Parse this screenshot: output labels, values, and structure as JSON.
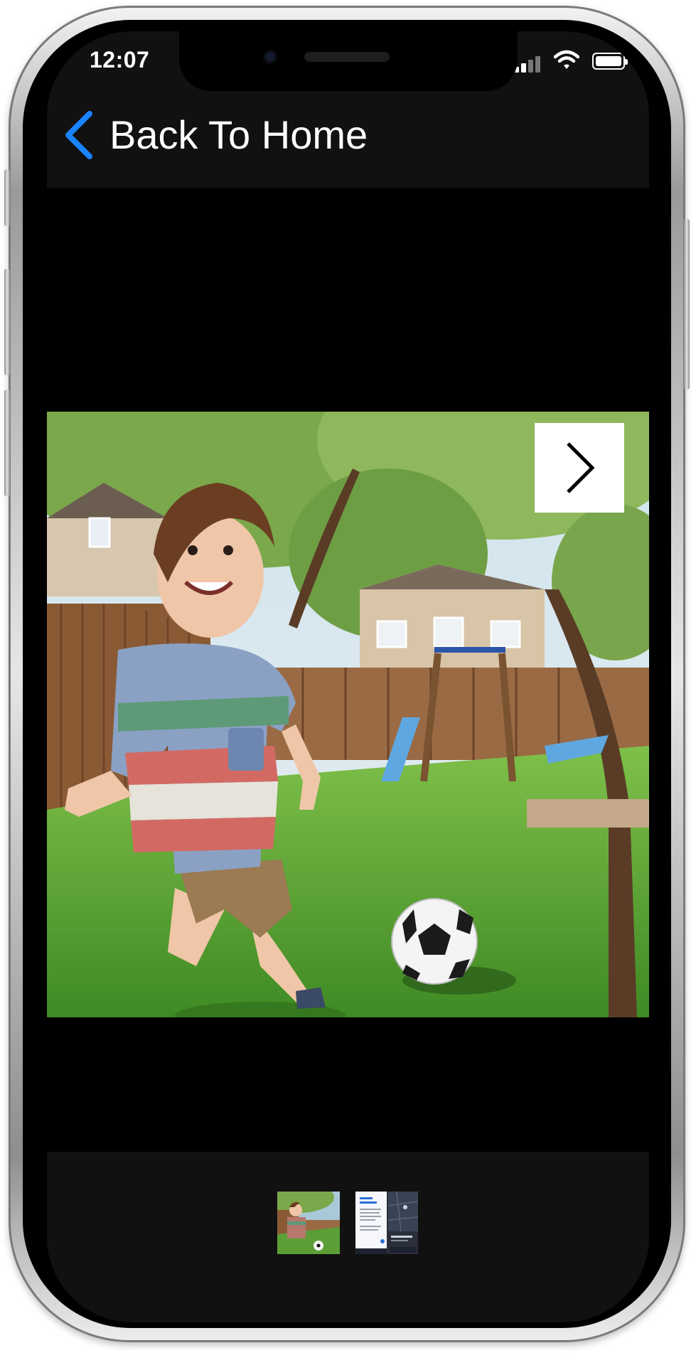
{
  "status_bar": {
    "time": "12:07",
    "icons": [
      "cellular-signal-icon",
      "wifi-icon",
      "battery-icon"
    ]
  },
  "nav": {
    "back_label": "Back To Home",
    "back_icon": "chevron-left-icon",
    "accent_color": "#1a84ff"
  },
  "viewer": {
    "image_subject": "boy-playing-soccer-in-backyard",
    "next_icon": "chevron-right-icon"
  },
  "thumbnails": [
    {
      "name": "thumbnail-boy-soccer",
      "selected": true
    },
    {
      "name": "thumbnail-app-screenshot",
      "selected": false
    }
  ]
}
